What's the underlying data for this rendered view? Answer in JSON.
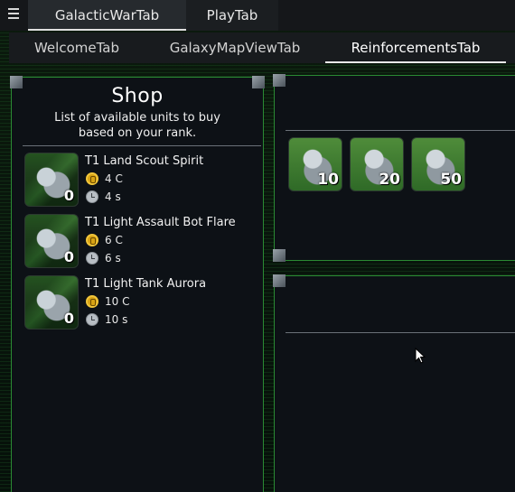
{
  "top_tabs": [
    {
      "label": "GalacticWarTab",
      "active": true
    },
    {
      "label": "PlayTab",
      "active": false
    }
  ],
  "sub_tabs": [
    {
      "label": "WelcomeTab",
      "active": false
    },
    {
      "label": "GalaxyMapViewTab",
      "active": false
    },
    {
      "label": "ReinforcementsTab",
      "active": true
    }
  ],
  "shop": {
    "title": "Shop",
    "subtitle_line1": "List of available units to buy",
    "subtitle_line2": "based on your rank.",
    "units": [
      {
        "name": "T1 Land Scout Spirit",
        "count": "0",
        "cost": "4 C",
        "time": "4 s"
      },
      {
        "name": "T1 Light Assault Bot Flare",
        "count": "0",
        "cost": "6 C",
        "time": "6 s"
      },
      {
        "name": "T1 Light Tank Aurora",
        "count": "0",
        "cost": "10 C",
        "time": "10 s"
      }
    ]
  },
  "reinforcements": {
    "tiles": [
      {
        "unit_icon": "scout-unit-icon",
        "count": "10"
      },
      {
        "unit_icon": "assault-bot-unit-icon",
        "count": "20"
      },
      {
        "unit_icon": "tank-unit-icon",
        "count": "50"
      }
    ]
  },
  "colors": {
    "accent_green": "#2a8a33",
    "panel_bg": "#0d1116",
    "tab_bg": "#181b1e"
  }
}
